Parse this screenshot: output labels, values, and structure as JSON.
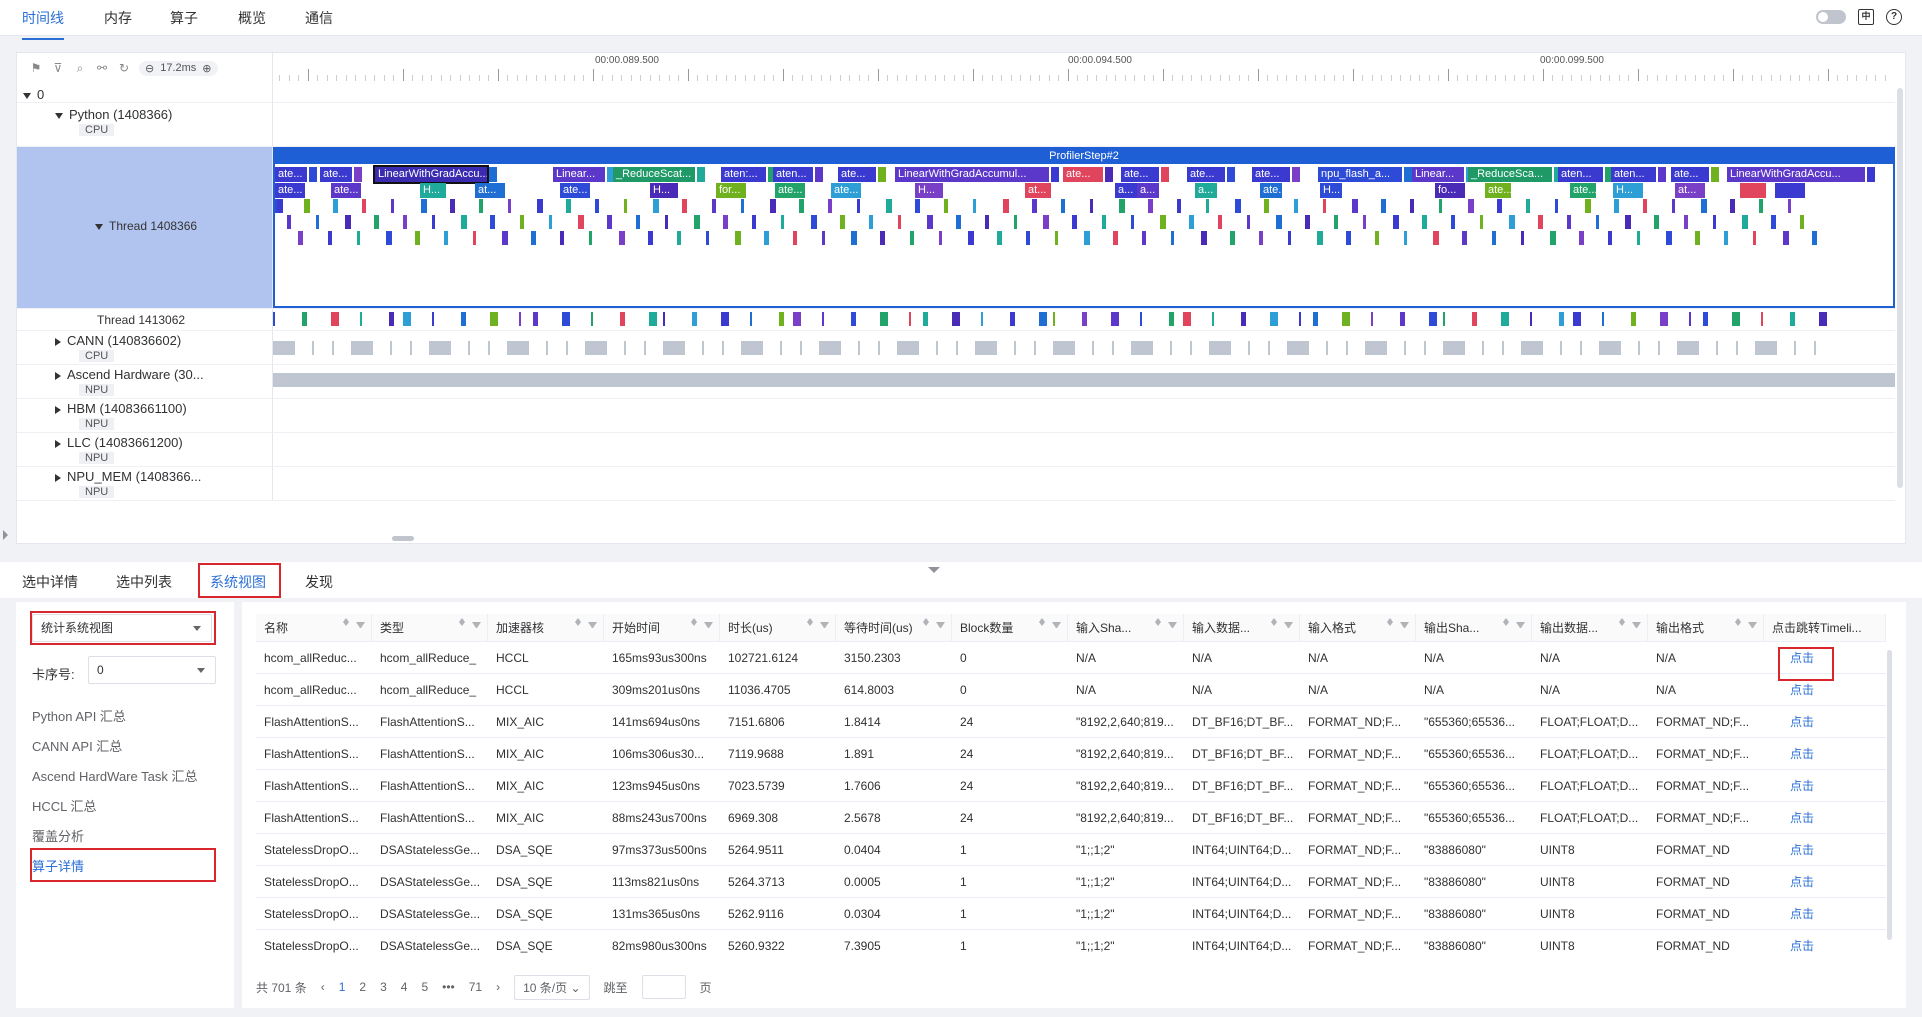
{
  "top_tabs": [
    "时间线",
    "内存",
    "算子",
    "概览",
    "通信"
  ],
  "timeline": {
    "zoom": "17.2ms",
    "ticks": [
      "00:00.089.500",
      "00:00.094.500",
      "00:00.099.500"
    ],
    "root_label": "0",
    "rows": [
      {
        "name": "Python (1408366)",
        "sub": "CPU"
      },
      {
        "name": "Thread 1408366",
        "sub": ""
      },
      {
        "name": "Thread 1413062",
        "sub": ""
      },
      {
        "name": "CANN (140836602)",
        "sub": "CPU"
      },
      {
        "name": "Ascend Hardware (30...",
        "sub": "NPU"
      },
      {
        "name": "HBM (14083661100)",
        "sub": "NPU"
      },
      {
        "name": "LLC (14083661200)",
        "sub": "NPU"
      },
      {
        "name": "NPU_MEM (1408366...",
        "sub": "NPU"
      }
    ],
    "profiler_step": "ProfilerStep#2",
    "flame_labels": [
      "ate...",
      "ate...",
      "LinearWithGradAccu...",
      "Linear...",
      "_ReduceScat...",
      "aten:...",
      "aten...",
      "ate...",
      "LinearWithGradAccumul...",
      "ate...",
      "ate...",
      "ate...",
      "ate...",
      "npu_flash_a...",
      "Linear...",
      "_ReduceSca...",
      "aten...",
      "aten...",
      "ate...",
      "LinearWithGradAccu..."
    ],
    "flame_labels2": [
      "ate...",
      "ate...",
      "H...",
      "at...",
      "ate...",
      "H...",
      "for...",
      "ate...",
      "ate...",
      "H...",
      "at...",
      "a...",
      "a...",
      "a...",
      "ate...",
      "H...",
      "fo...",
      "ate...",
      "ate...",
      "H...",
      "at..."
    ]
  },
  "bottom_tabs": [
    "选中详情",
    "选中列表",
    "系统视图",
    "发现"
  ],
  "left_panel": {
    "view_select": "统计系统视图",
    "card_label": "卡序号:",
    "card_value": "0",
    "items": [
      "Python API 汇总",
      "CANN API 汇总",
      "Ascend HardWare Task 汇总",
      "HCCL 汇总",
      "覆盖分析",
      "算子详情"
    ]
  },
  "table": {
    "columns": [
      "名称",
      "类型",
      "加速器核",
      "开始时间",
      "时长(us)",
      "等待时间(us)",
      "Block数量",
      "输入Sha...",
      "输入数据...",
      "输入格式",
      "输出Sha...",
      "输出数据...",
      "输出格式",
      "点击跳转Timeli..."
    ],
    "rows": [
      [
        "hcom_allReduc...",
        "hcom_allReduce_",
        "HCCL",
        "165ms93us300ns",
        "102721.6124",
        "3150.2303",
        "0",
        "N/A",
        "N/A",
        "N/A",
        "N/A",
        "N/A",
        "N/A",
        "点击"
      ],
      [
        "hcom_allReduc...",
        "hcom_allReduce_",
        "HCCL",
        "309ms201us0ns",
        "11036.4705",
        "614.8003",
        "0",
        "N/A",
        "N/A",
        "N/A",
        "N/A",
        "N/A",
        "N/A",
        "点击"
      ],
      [
        "FlashAttentionS...",
        "FlashAttentionS...",
        "MIX_AIC",
        "141ms694us0ns",
        "7151.6806",
        "1.8414",
        "24",
        "\"8192,2,640;819...",
        "DT_BF16;DT_BF...",
        "FORMAT_ND;F...",
        "\"655360;65536...",
        "FLOAT;FLOAT;D...",
        "FORMAT_ND;F...",
        "点击"
      ],
      [
        "FlashAttentionS...",
        "FlashAttentionS...",
        "MIX_AIC",
        "106ms306us30...",
        "7119.9688",
        "1.891",
        "24",
        "\"8192,2,640;819...",
        "DT_BF16;DT_BF...",
        "FORMAT_ND;F...",
        "\"655360;65536...",
        "FLOAT;FLOAT;D...",
        "FORMAT_ND;F...",
        "点击"
      ],
      [
        "FlashAttentionS...",
        "FlashAttentionS...",
        "MIX_AIC",
        "123ms945us0ns",
        "7023.5739",
        "1.7606",
        "24",
        "\"8192,2,640;819...",
        "DT_BF16;DT_BF...",
        "FORMAT_ND;F...",
        "\"655360;65536...",
        "FLOAT;FLOAT;D...",
        "FORMAT_ND;F...",
        "点击"
      ],
      [
        "FlashAttentionS...",
        "FlashAttentionS...",
        "MIX_AIC",
        "88ms243us700ns",
        "6969.308",
        "2.5678",
        "24",
        "\"8192,2,640;819...",
        "DT_BF16;DT_BF...",
        "FORMAT_ND;F...",
        "\"655360;65536...",
        "FLOAT;FLOAT;D...",
        "FORMAT_ND;F...",
        "点击"
      ],
      [
        "StatelessDropO...",
        "DSAStatelessGe...",
        "DSA_SQE",
        "97ms373us500ns",
        "5264.9511",
        "0.0404",
        "1",
        "\"1;;1;2\"",
        "INT64;UINT64;D...",
        "FORMAT_ND;F...",
        "\"83886080\"",
        "UINT8",
        "FORMAT_ND",
        "点击"
      ],
      [
        "StatelessDropO...",
        "DSAStatelessGe...",
        "DSA_SQE",
        "113ms821us0ns",
        "5264.3713",
        "0.0005",
        "1",
        "\"1;;1;2\"",
        "INT64;UINT64;D...",
        "FORMAT_ND;F...",
        "\"83886080\"",
        "UINT8",
        "FORMAT_ND",
        "点击"
      ],
      [
        "StatelessDropO...",
        "DSAStatelessGe...",
        "DSA_SQE",
        "131ms365us0ns",
        "5262.9116",
        "0.0304",
        "1",
        "\"1;;1;2\"",
        "INT64;UINT64;D...",
        "FORMAT_ND;F...",
        "\"83886080\"",
        "UINT8",
        "FORMAT_ND",
        "点击"
      ],
      [
        "StatelessDropO...",
        "DSAStatelessGe...",
        "DSA_SQE",
        "82ms980us300ns",
        "5260.9322",
        "7.3905",
        "1",
        "\"1;;1;2\"",
        "INT64;UINT64;D...",
        "FORMAT_ND;F...",
        "\"83886080\"",
        "UINT8",
        "FORMAT_ND",
        "点击"
      ]
    ]
  },
  "pager": {
    "total": "共 701 条",
    "pages": [
      "1",
      "2",
      "3",
      "4",
      "5",
      "•••",
      "71"
    ],
    "page_size": "10 条/页",
    "jump_label": "跳至",
    "page_suffix": "页"
  }
}
